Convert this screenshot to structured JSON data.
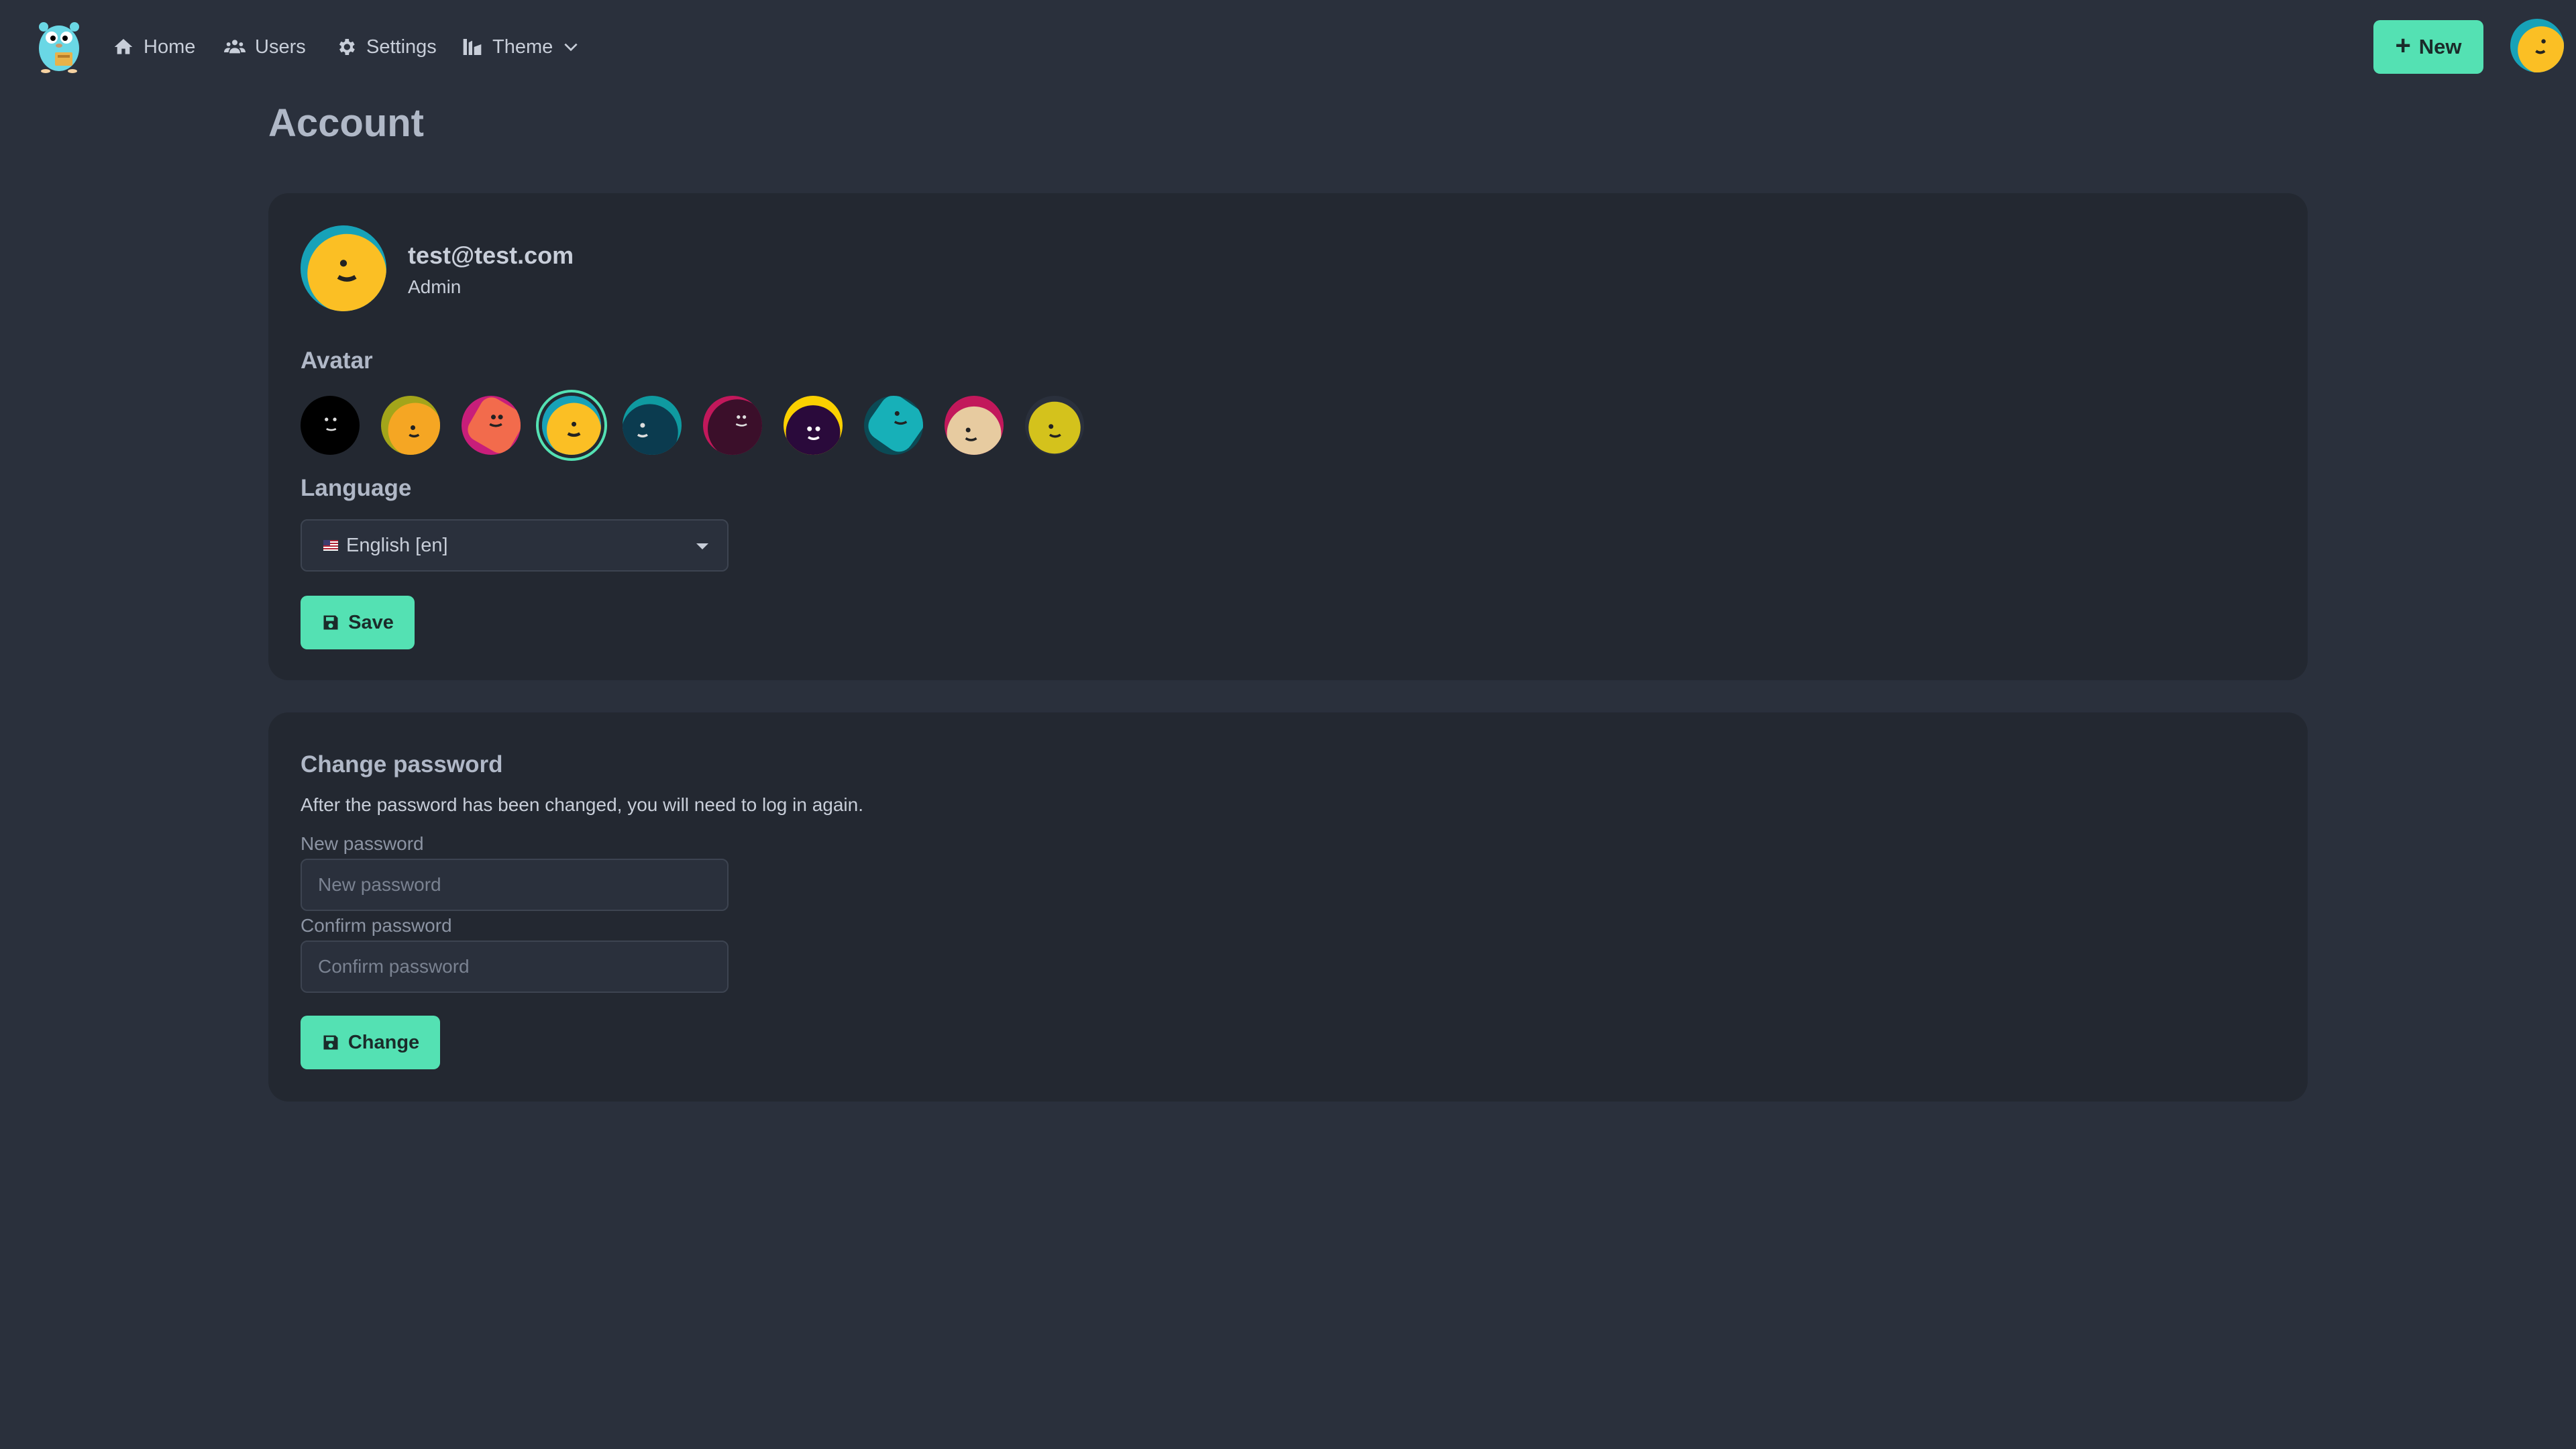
{
  "nav": {
    "items": [
      {
        "label": "Home",
        "icon": "home-icon"
      },
      {
        "label": "Users",
        "icon": "users-icon"
      },
      {
        "label": "Settings",
        "icon": "gear-icon"
      },
      {
        "label": "Theme",
        "icon": "theme-icon"
      }
    ],
    "new_button": "New"
  },
  "page": {
    "title": "Account"
  },
  "profile": {
    "email": "test@test.com",
    "role": "Admin"
  },
  "avatar": {
    "label": "Avatar",
    "selected_index": 3,
    "options": [
      "black",
      "orange-olive",
      "pink-coral",
      "yellow-teal",
      "dark-teal",
      "maroon",
      "purple-yellow",
      "teal",
      "beige-pink",
      "yellow-olive"
    ]
  },
  "language": {
    "label": "Language",
    "selected": "English [en]"
  },
  "save_button": "Save",
  "password": {
    "title": "Change password",
    "description": "After the password has been changed, you will need to log in again.",
    "new_label": "New password",
    "new_placeholder": "New password",
    "confirm_label": "Confirm password",
    "confirm_placeholder": "Confirm password",
    "change_button": "Change"
  },
  "colors": {
    "background": "#2a303c",
    "card": "#232831",
    "accent": "#54e1b3"
  }
}
